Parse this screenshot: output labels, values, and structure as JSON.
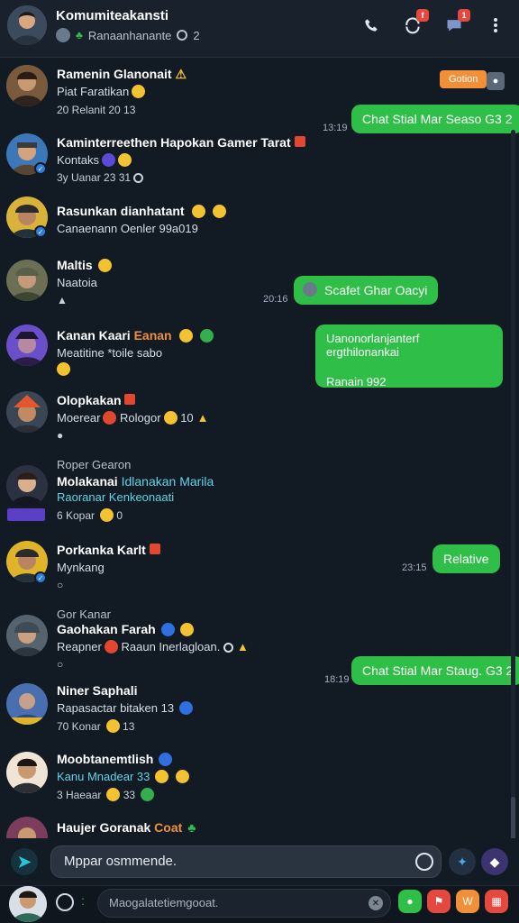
{
  "header": {
    "title": "Komumiteakansti",
    "subtitle": "Ranaanhanante",
    "subtitle_count": "2",
    "actions": [
      {
        "icon": "phone-icon",
        "badge": ""
      },
      {
        "icon": "refresh-icon",
        "badge": "f"
      },
      {
        "icon": "chat-icon",
        "badge": "1"
      },
      {
        "icon": "more-vert-icon",
        "badge": ""
      }
    ]
  },
  "rows": [
    {
      "name": "Ramenin Glanonait",
      "line1": "Piat Faratikan",
      "meta": "20 Relanit  20 13",
      "avatar_bg": "#7a5a3c",
      "verified": false
    },
    {
      "name": "Kaminterreethen Hapokan Gamer Tarat",
      "line1": "Kontaks",
      "meta": "3y Uanar  23 31",
      "avatar_bg": "#3c78b8",
      "verified": true
    },
    {
      "name": "Rasunkan dianhatant",
      "line1": "Canaenann Oenler 99a019",
      "meta": "",
      "avatar_bg": "#d9b23a",
      "verified": true
    },
    {
      "name": "Maltis",
      "line1": "Naatoia",
      "meta": "",
      "avatar_bg": "#6b6f54",
      "verified": false
    },
    {
      "name": "Kanan Kaari",
      "name_accent": "Eanan",
      "line1": "Meatitine  *toile sabo",
      "meta": "",
      "avatar_bg": "#6a4fc9",
      "verified": false
    },
    {
      "name": "Olopkakan",
      "line1": "Moerear",
      "line1b": "Rologor",
      "line1c": "10",
      "meta": "",
      "avatar_bg": "#e2572e",
      "verified": false
    },
    {
      "pre": "Roper Gearon",
      "name": "Molakanai",
      "name_accent": "Idlanakan Marila",
      "line1": "Raoranar Kenkeonaati",
      "meta": "6 Kopar",
      "meta_count": "0",
      "avatar_bg": "#2b3140",
      "verified": false
    },
    {
      "name": "Porkanka Karlt",
      "line1": "Mynkang",
      "meta": "",
      "avatar_bg": "#e0b42a",
      "verified": false
    },
    {
      "pre": "Gor Kanar",
      "name": "Gaohakan Farah",
      "line1": "Reapner",
      "line1b": "Raaun Inerlagloan.",
      "meta": "",
      "avatar_bg": "#55636e",
      "verified": false
    },
    {
      "name": "Niner Saphali",
      "line1": "Rapasactar bitaken 13",
      "meta": "70 Konar",
      "meta_count": "13",
      "avatar_bg": "#4a6fb0",
      "verified": false
    },
    {
      "name": "Moobtanemtlish",
      "line1": "Kanu Mnadear 33",
      "meta": "3 Haeaar",
      "meta_count": "33",
      "avatar_bg": "#f0e4d6",
      "verified": false
    },
    {
      "name": "Haujer Goranak",
      "name_accent": "Coat",
      "line1": "",
      "meta": "",
      "avatar_bg": "#7c3d5c",
      "verified": false
    }
  ],
  "messages": [
    {
      "text": "Chat Stial Mar Seaso G3 2",
      "time": "13:19"
    },
    {
      "text": "Scafet Ghar Oacyi",
      "time": "20:16"
    },
    {
      "text": "Uanonorlanjanterf ergthilonankai",
      "text2": "Ranain 992",
      "time": ""
    },
    {
      "text": "Relative",
      "time": "23:15"
    },
    {
      "text": "Chat Stial Mar Staug. G3 2",
      "time": "18:19"
    }
  ],
  "tag": {
    "label": "Gotion"
  },
  "composer": {
    "placeholder": "Mppar osmmende."
  },
  "bottom_bar": {
    "placeholder": "Maogalatetiemgooat."
  },
  "colors": {
    "accent_green": "#2fbf48",
    "accent_orange": "#f2903a",
    "badge_red": "#e5483f",
    "background": "#121a24"
  }
}
